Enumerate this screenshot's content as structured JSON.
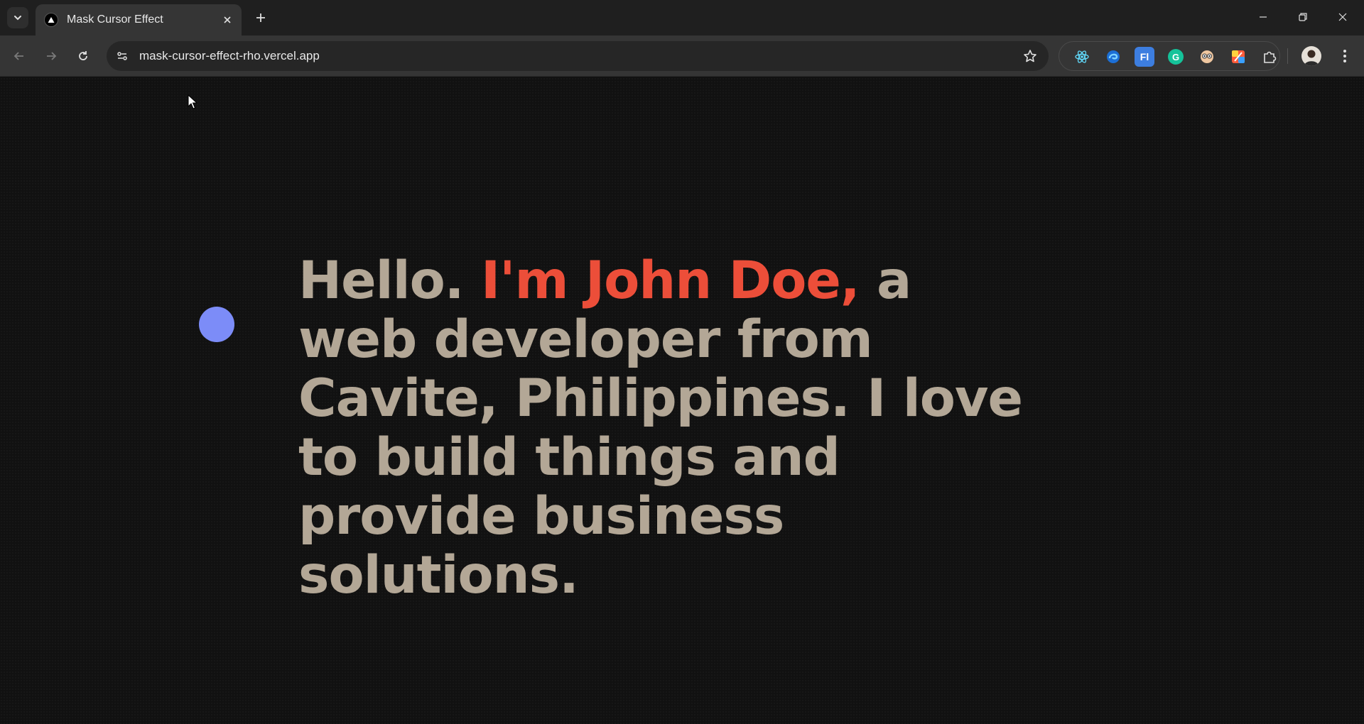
{
  "browser": {
    "tab": {
      "title": "Mask Cursor Effect"
    },
    "address_bar": {
      "url": "mask-cursor-effect-rho.vercel.app"
    },
    "extensions": [
      "react-devtools-icon",
      "edge-icon",
      "fl-icon",
      "grammarly-icon",
      "eyes-icon",
      "colorpick-icon",
      "puzzle-icon"
    ],
    "extension_labels": {
      "fl": "Fl",
      "grammarly": "G"
    }
  },
  "page": {
    "headline_before": "Hello. ",
    "headline_accent": "I'm John Doe,",
    "headline_after": " a web developer from Cavite, Philippines. I love to build things and provide business solutions.",
    "colors": {
      "text": "#b3a796",
      "accent": "#ec4e39",
      "cursor_dot": "#7c8cf8",
      "background": "#111111"
    }
  }
}
